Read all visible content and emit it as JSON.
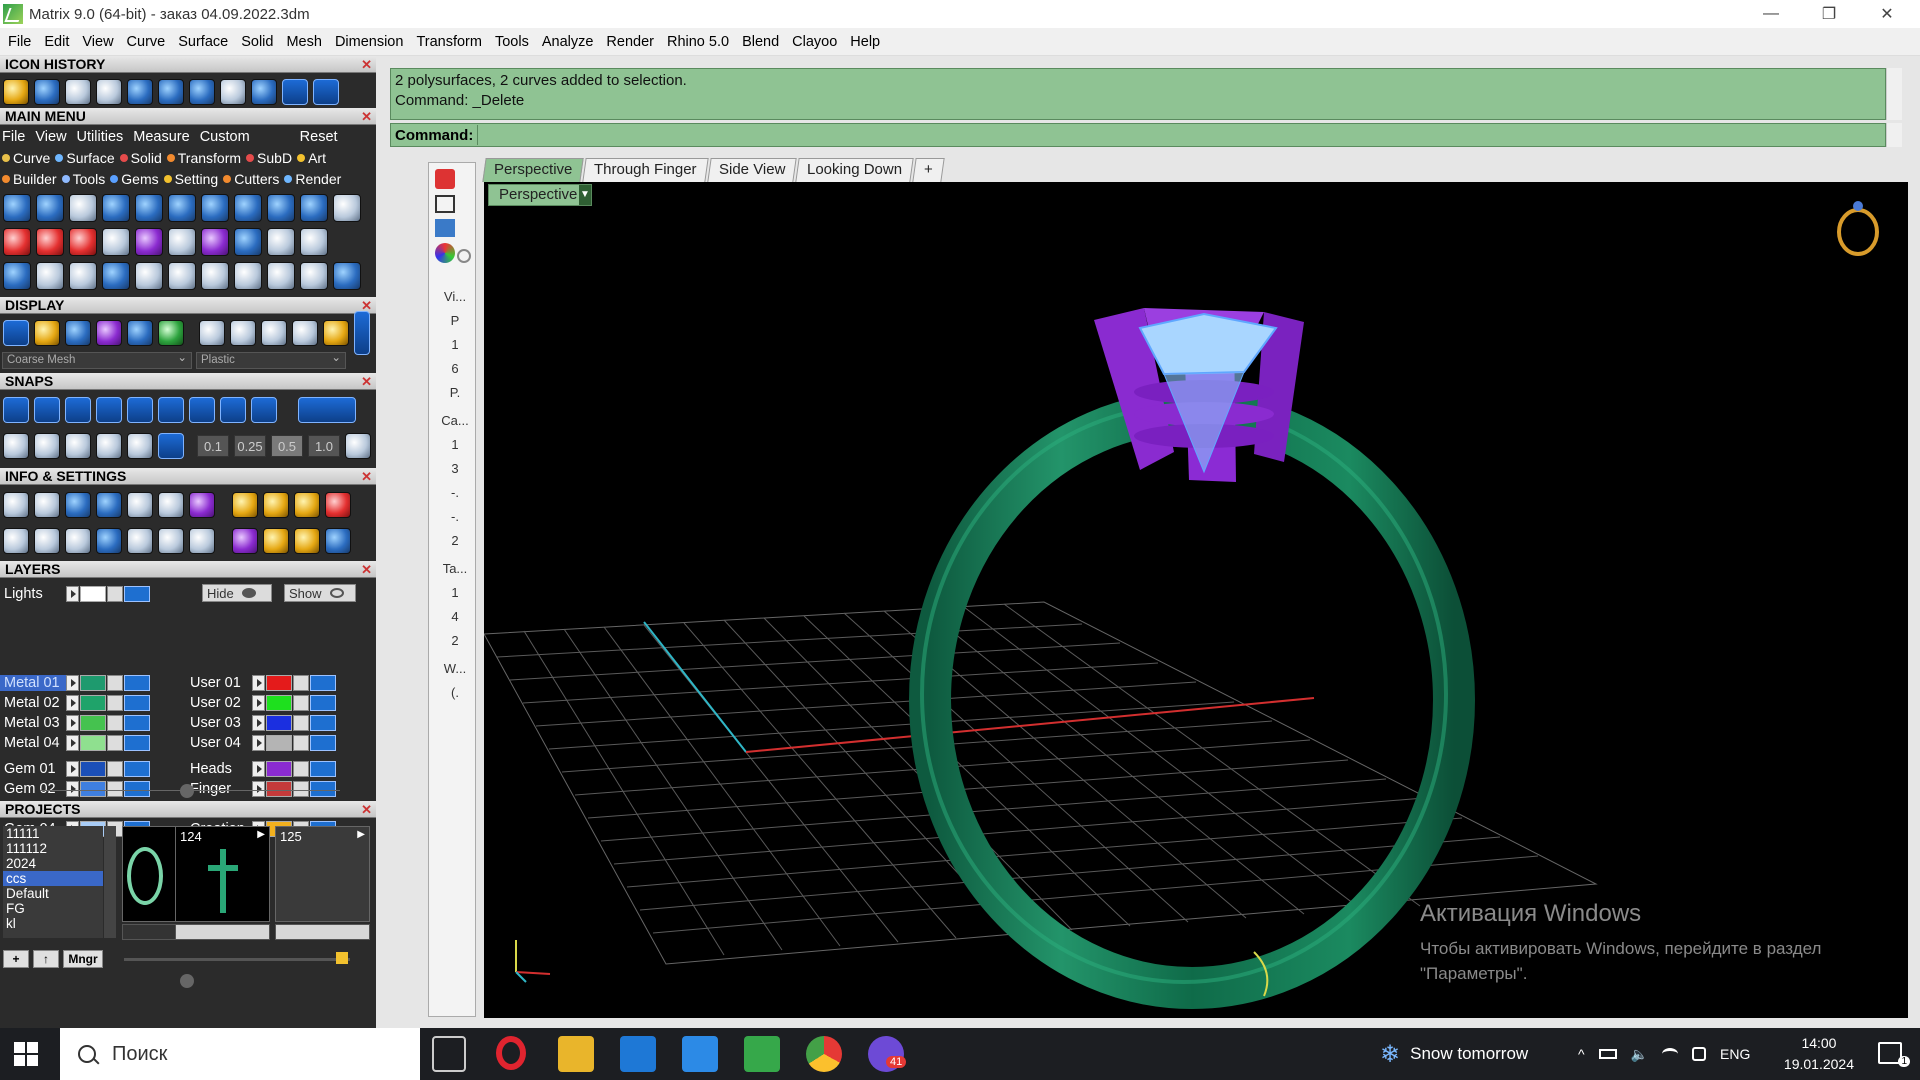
{
  "window": {
    "title": "Matrix 9.0 (64-bit) - заказ 04.09.2022.3dm",
    "min_glyph": "—",
    "restore_glyph": "❐",
    "close_glyph": "✕"
  },
  "menubar": [
    "File",
    "Edit",
    "View",
    "Curve",
    "Surface",
    "Solid",
    "Mesh",
    "Dimension",
    "Transform",
    "Tools",
    "Analyze",
    "Render",
    "Rhino 5.0",
    "Blend",
    "Clayoo",
    "Help"
  ],
  "panels": {
    "icon_history": "ICON HISTORY",
    "main_menu": "MAIN MENU",
    "display": "DISPLAY",
    "snaps": "SNAPS",
    "info_settings": "INFO & SETTINGS",
    "layers": "LAYERS",
    "projects": "PROJECTS",
    "close_glyph": "✕"
  },
  "main_menu_bar": [
    "File",
    "View",
    "Utilities",
    "Measure",
    "Custom",
    "Reset"
  ],
  "main_menu_tabs_row1": [
    "Curve",
    "Surface",
    "Solid",
    "Transform",
    "SubD",
    "Art"
  ],
  "main_menu_tabs_row2": [
    "Builder",
    "Tools",
    "Gems",
    "Setting",
    "Cutters",
    "Render"
  ],
  "tab_dot_colors": [
    "#e8c04a",
    "#6fb7ff",
    "#e54b4b",
    "#f28a2e",
    "#e54b4b",
    "#f2c12e",
    "#f28a2e",
    "#8fbaff",
    "#5aa0ff",
    "#f2c12e",
    "#f28a2e",
    "#6fb7ff"
  ],
  "display": {
    "mesh_combo": "Coarse Mesh",
    "material_combo": "Plastic"
  },
  "snaps": {
    "values": [
      "0.1",
      "0.25",
      "0.5",
      "1.0"
    ]
  },
  "layers": {
    "lights": "Lights",
    "hide": "Hide",
    "show": "Show",
    "left": [
      {
        "name": "Metal 01",
        "color": "#1e9a6e",
        "selected": true
      },
      {
        "name": "Metal 02",
        "color": "#1fa36a"
      },
      {
        "name": "Metal 03",
        "color": "#45c24f"
      },
      {
        "name": "Metal 04",
        "color": "#8fe08f"
      },
      {
        "name": "Gem 01",
        "color": "#1b4fb8"
      },
      {
        "name": "Gem 02",
        "color": "#3f7fe0"
      },
      {
        "name": "Gem 03",
        "color": "#79aef0"
      },
      {
        "name": "Gem 04",
        "color": "#a9cdf7"
      }
    ],
    "right": [
      {
        "name": "User 01",
        "color": "#e41b1b"
      },
      {
        "name": "User 02",
        "color": "#1ee01e"
      },
      {
        "name": "User 03",
        "color": "#1b2fe0"
      },
      {
        "name": "User 04",
        "color": "#b4b4b4"
      },
      {
        "name": "Heads",
        "color": "#8a2bd0"
      },
      {
        "name": "Finger",
        "color": "#c43a3a"
      },
      {
        "name": "Cutting",
        "color": "#f28a1e"
      },
      {
        "name": "Creation",
        "color": "#f2b01e"
      }
    ]
  },
  "projects": {
    "list": [
      "11111",
      "111112",
      "2024",
      "ccs",
      "Default",
      "FG",
      "kl"
    ],
    "selected": "ccs",
    "thumbs": [
      {
        "label": ""
      },
      {
        "label": "124"
      },
      {
        "label": "125"
      }
    ],
    "buttons": [
      "+",
      "↑",
      "Mngr"
    ]
  },
  "command": {
    "history": [
      "2 polysurfaces, 2 curves added to selection.",
      "Command: _Delete"
    ],
    "label": "Command:",
    "value": ""
  },
  "view_tabs": [
    "Perspective",
    "Through Finger",
    "Side View",
    "Looking Down",
    "+"
  ],
  "active_tab": "Perspective",
  "viewport_label": "Perspective",
  "side_strip": [
    "Vi...",
    "P",
    "1",
    "6",
    "P.",
    "Ca...",
    "1",
    "3",
    "-.",
    "-.",
    "2",
    "Ta...",
    "1",
    "4",
    "2",
    "W...",
    "(."
  ],
  "watermark": {
    "title": "Активация Windows",
    "line1": "Чтобы активировать Windows, перейдите в раздел",
    "line2": "\"Параметры\"."
  },
  "taskbar": {
    "search": "Поиск",
    "weather": "Snow tomorrow",
    "lang": "ENG",
    "time": "14:00",
    "date": "19.01.2024",
    "badge": "41"
  }
}
